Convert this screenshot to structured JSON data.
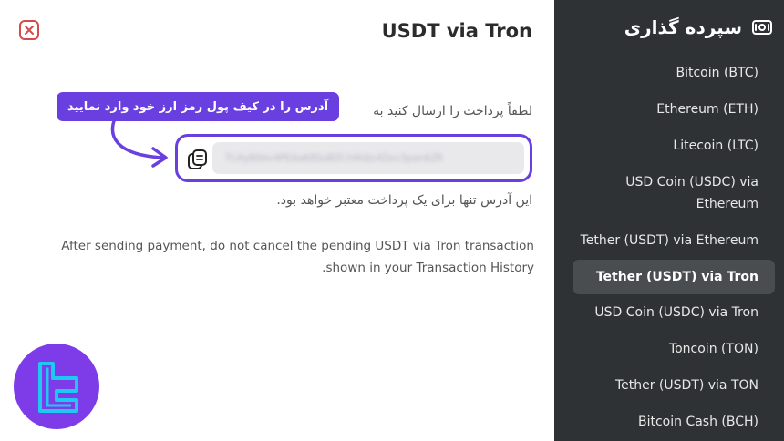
{
  "main": {
    "title": "USDT via Tron",
    "instruction": "لطفاً پرداخت را ارسال کنید به",
    "callout": "آدرس را در کیف پول رمز ارز خود وارد نمایید",
    "address": "TLHyBXmv4PEAaK8SoBZCtHhQs4Zev3panAZR",
    "valid_note": "این آدرس تنها برای یک پرداخت معتبر خواهد بود.",
    "warning": "After sending payment, do not cancel the pending USDT via Tron transaction shown in your Transaction History."
  },
  "sidebar": {
    "title": "سپرده گذاری",
    "items": [
      {
        "label": "Bitcoin (BTC)"
      },
      {
        "label": "Ethereum (ETH)"
      },
      {
        "label": "Litecoin (LTC)"
      },
      {
        "label": "USD Coin (USDC) via Ethereum"
      },
      {
        "label": "Tether (USDT) via Ethereum"
      },
      {
        "label": "Tether (USDT) via Tron"
      },
      {
        "label": "USD Coin (USDC) via Tron"
      },
      {
        "label": "Toncoin (TON)"
      },
      {
        "label": "Tether (USDT) via TON"
      },
      {
        "label": "Bitcoin Cash (BCH)"
      }
    ],
    "active_index": 5
  },
  "colors": {
    "accent": "#6a3fe0",
    "close": "#d64a4a",
    "sidebar_bg": "#2f3234",
    "logo_bg": "#7d3ce8",
    "logo_mark": "#1fc8f2"
  },
  "icons": {
    "close": "close-icon",
    "copy": "copy-icon",
    "deposit": "cash-icon",
    "arrow": "curved-arrow-icon",
    "logo": "brand-logo"
  }
}
